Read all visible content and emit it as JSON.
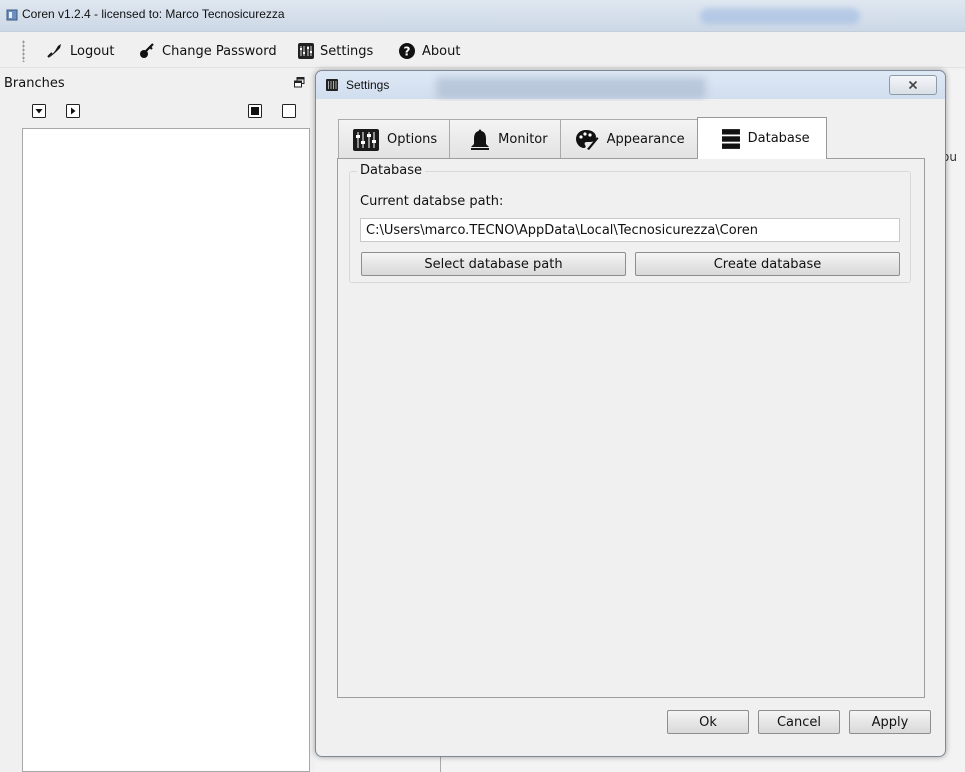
{
  "window": {
    "title": "Coren v1.2.4 - licensed to: Marco Tecnosicurezza"
  },
  "toolbar": {
    "logout": "Logout",
    "change_password": "Change Password",
    "settings": "Settings",
    "about": "About"
  },
  "branches": {
    "title": "Branches"
  },
  "background": {
    "cut_text": "ou"
  },
  "dialog": {
    "title": "Settings",
    "tabs": [
      {
        "label": "Options",
        "icon": "sliders-icon"
      },
      {
        "label": "Monitor",
        "icon": "bell-icon"
      },
      {
        "label": "Appearance",
        "icon": "palette-icon"
      },
      {
        "label": "Database",
        "icon": "database-icon"
      }
    ],
    "active_tab": "Database",
    "database": {
      "group_title": "Database",
      "path_label": "Current databse path:",
      "path_value": "C:\\Users\\marco.TECNO\\AppData\\Local\\Tecnosicurezza\\Coren",
      "select_button": "Select database path",
      "create_button": "Create database"
    },
    "footer": {
      "ok": "Ok",
      "cancel": "Cancel",
      "apply": "Apply"
    }
  }
}
